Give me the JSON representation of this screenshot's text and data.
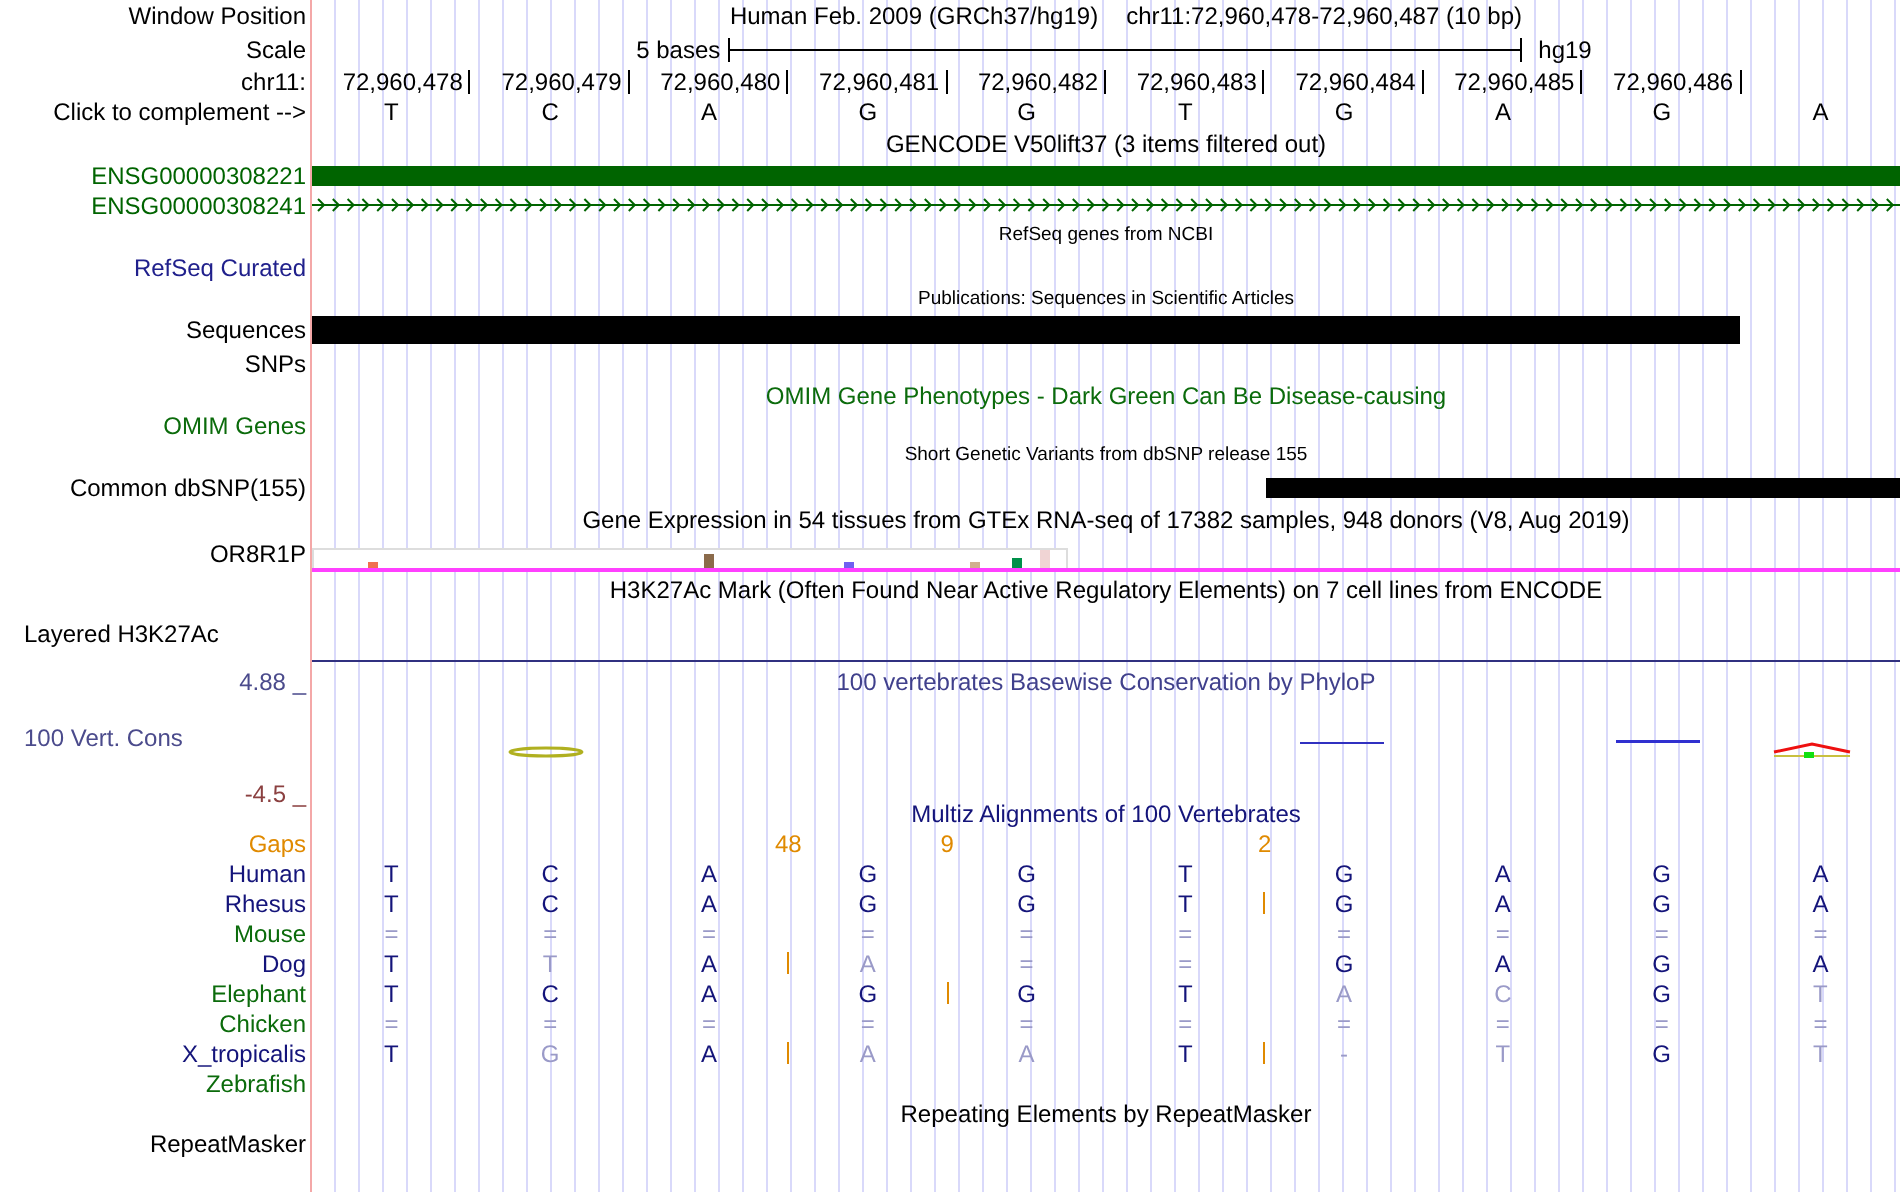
{
  "window_position": {
    "label": "Window Position",
    "assembly": "Human Feb. 2009 (GRCh37/hg19)",
    "range": "chr11:72,960,478-72,960,487 (10 bp)"
  },
  "scale": {
    "label": "Scale",
    "length": "5 bases",
    "assembly": "hg19"
  },
  "ruler": {
    "label": "chr11:",
    "positions": [
      "72,960,478",
      "72,960,479",
      "72,960,480",
      "72,960,481",
      "72,960,482",
      "72,960,483",
      "72,960,484",
      "72,960,485",
      "72,960,486"
    ]
  },
  "sequence": {
    "label": "Click to complement -->",
    "bases": [
      "T",
      "C",
      "A",
      "G",
      "G",
      "T",
      "G",
      "A",
      "G",
      "A"
    ]
  },
  "gencode": {
    "title": "GENCODE V50lift37 (3 items filtered out)",
    "genes": [
      {
        "name": "ENSG00000308221",
        "kind": "block"
      },
      {
        "name": "ENSG00000308241",
        "kind": "strand"
      }
    ]
  },
  "refseq": {
    "title": "RefSeq genes from NCBI",
    "label": "RefSeq Curated"
  },
  "publications": {
    "title": "Publications: Sequences in Scientific Articles",
    "label": "Sequences",
    "sublabel": "SNPs"
  },
  "omim": {
    "title": "OMIM Gene Phenotypes - Dark Green Can Be Disease-causing",
    "label": "OMIM Genes"
  },
  "dbsnp": {
    "title": "Short Genetic Variants from dbSNP release 155",
    "label": "Common dbSNP(155)"
  },
  "gtex": {
    "title": "Gene Expression in 54 tissues from GTEx RNA-seq of 17382 samples, 948 donors (V8, Aug 2019)",
    "label": "OR8R1P"
  },
  "h3k27ac": {
    "title": "H3K27Ac Mark (Often Found Near Active Regulatory Elements) on 7 cell lines from ENCODE",
    "label": "Layered H3K27Ac"
  },
  "phylop": {
    "title": "100 vertebrates Basewise Conservation by PhyloP",
    "label": "100 Vert. Cons",
    "max": "4.88 _",
    "min": "-4.5 _"
  },
  "multiz": {
    "title": "Multiz Alignments of 100 Vertebrates",
    "gaps": {
      "label": "Gaps",
      "columns": [
        {},
        {},
        {
          "count": "48"
        },
        {
          "count": "9"
        },
        {},
        {
          "count": "2"
        },
        {},
        {},
        {},
        {}
      ]
    },
    "species": [
      {
        "name": "Human",
        "color": "#14147a",
        "bases": [
          {
            "kind": "base",
            "b": "T",
            "match": true
          },
          {
            "kind": "base",
            "b": "C",
            "match": true
          },
          {
            "kind": "base",
            "b": "A",
            "match": true
          },
          {
            "kind": "base",
            "b": "G",
            "match": true
          },
          {
            "kind": "base",
            "b": "G",
            "match": true
          },
          {
            "kind": "base",
            "b": "T",
            "match": true
          },
          {
            "kind": "base",
            "b": "G",
            "match": true
          },
          {
            "kind": "base",
            "b": "A",
            "match": true
          },
          {
            "kind": "base",
            "b": "G",
            "match": true
          },
          {
            "kind": "base",
            "b": "A",
            "match": true
          }
        ]
      },
      {
        "name": "Rhesus",
        "color": "#14147a",
        "bases": [
          {
            "kind": "base",
            "b": "T",
            "match": true
          },
          {
            "kind": "base",
            "b": "C",
            "match": true
          },
          {
            "kind": "base",
            "b": "A",
            "match": true
          },
          {
            "kind": "base",
            "b": "G",
            "match": true
          },
          {
            "kind": "base",
            "b": "G",
            "match": true
          },
          {
            "kind": "base",
            "b": "T",
            "match": true
          },
          {
            "kind": "insertion"
          },
          {
            "kind": "base",
            "b": "G",
            "match": true
          },
          {
            "kind": "base",
            "b": "A",
            "match": true
          },
          {
            "kind": "base",
            "b": "G",
            "match": true
          },
          {
            "kind": "base",
            "b": "A",
            "match": true
          }
        ]
      },
      {
        "name": "Mouse",
        "color": "#0b6b0b",
        "bases": [
          {
            "kind": "base",
            "b": "=",
            "match": false
          },
          {
            "kind": "base",
            "b": "=",
            "match": false
          },
          {
            "kind": "base",
            "b": "=",
            "match": false
          },
          {
            "kind": "base",
            "b": "=",
            "match": false
          },
          {
            "kind": "base",
            "b": "=",
            "match": false
          },
          {
            "kind": "base",
            "b": "=",
            "match": false
          },
          {
            "kind": "base",
            "b": "=",
            "match": false
          },
          {
            "kind": "base",
            "b": "=",
            "match": false
          },
          {
            "kind": "base",
            "b": "=",
            "match": false
          },
          {
            "kind": "base",
            "b": "=",
            "match": false
          }
        ]
      },
      {
        "name": "Dog",
        "color": "#14147a",
        "bases": [
          {
            "kind": "base",
            "b": "T",
            "match": true
          },
          {
            "kind": "base",
            "b": "T",
            "match": false
          },
          {
            "kind": "base",
            "b": "A",
            "match": true
          },
          {
            "kind": "insertion"
          },
          {
            "kind": "base",
            "b": "A",
            "match": false
          },
          {
            "kind": "base",
            "b": "=",
            "match": false
          },
          {
            "kind": "base",
            "b": "=",
            "match": false
          },
          {
            "kind": "base",
            "b": "G",
            "match": true
          },
          {
            "kind": "base",
            "b": "A",
            "match": true
          },
          {
            "kind": "base",
            "b": "G",
            "match": true
          },
          {
            "kind": "base",
            "b": "A",
            "match": true
          }
        ]
      },
      {
        "name": "Elephant",
        "color": "#0b6b0b",
        "bases": [
          {
            "kind": "base",
            "b": "T",
            "match": true
          },
          {
            "kind": "base",
            "b": "C",
            "match": true
          },
          {
            "kind": "base",
            "b": "A",
            "match": true
          },
          {
            "kind": "base",
            "b": "G",
            "match": true
          },
          {
            "kind": "insertion"
          },
          {
            "kind": "base",
            "b": "G",
            "match": true
          },
          {
            "kind": "base",
            "b": "T",
            "match": true
          },
          {
            "kind": "base",
            "b": "A",
            "match": false
          },
          {
            "kind": "base",
            "b": "C",
            "match": false
          },
          {
            "kind": "base",
            "b": "G",
            "match": true
          },
          {
            "kind": "base",
            "b": "T",
            "match": false
          }
        ]
      },
      {
        "name": "Chicken",
        "color": "#0b6b0b",
        "bases": [
          {
            "kind": "base",
            "b": "=",
            "match": false
          },
          {
            "kind": "base",
            "b": "=",
            "match": false
          },
          {
            "kind": "base",
            "b": "=",
            "match": false
          },
          {
            "kind": "base",
            "b": "=",
            "match": false
          },
          {
            "kind": "base",
            "b": "=",
            "match": false
          },
          {
            "kind": "base",
            "b": "=",
            "match": false
          },
          {
            "kind": "base",
            "b": "=",
            "match": false
          },
          {
            "kind": "base",
            "b": "=",
            "match": false
          },
          {
            "kind": "base",
            "b": "=",
            "match": false
          },
          {
            "kind": "base",
            "b": "=",
            "match": false
          }
        ]
      },
      {
        "name": "X_tropicalis",
        "color": "#14147a",
        "bases": [
          {
            "kind": "base",
            "b": "T",
            "match": true
          },
          {
            "kind": "base",
            "b": "G",
            "match": false
          },
          {
            "kind": "base",
            "b": "A",
            "match": true
          },
          {
            "kind": "insertion"
          },
          {
            "kind": "base",
            "b": "A",
            "match": false
          },
          {
            "kind": "base",
            "b": "A",
            "match": false
          },
          {
            "kind": "base",
            "b": "T",
            "match": true
          },
          {
            "kind": "insertion"
          },
          {
            "kind": "base",
            "b": "-",
            "match": false
          },
          {
            "kind": "base",
            "b": "T",
            "match": false
          },
          {
            "kind": "base",
            "b": "G",
            "match": true
          },
          {
            "kind": "base",
            "b": "T",
            "match": false
          }
        ]
      },
      {
        "name": "Zebrafish",
        "color": "#0b6b0b"
      }
    ]
  },
  "repeatmasker": {
    "title": "Repeating Elements by RepeatMasker",
    "label": "RepeatMasker"
  }
}
